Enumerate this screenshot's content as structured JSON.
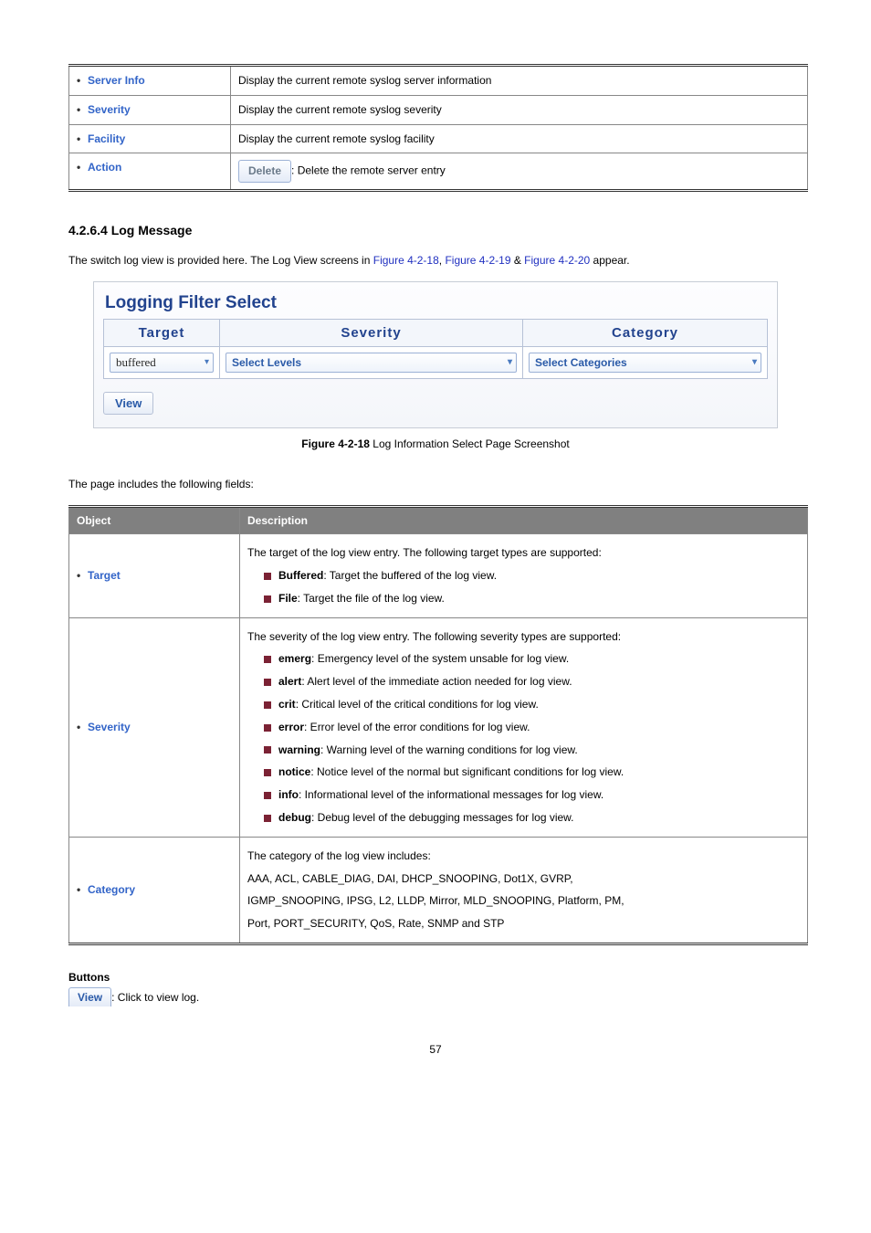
{
  "top_table": {
    "rows": [
      {
        "obj": "Server Info",
        "desc": "Display the current remote syslog server information"
      },
      {
        "obj": "Severity",
        "desc": "Display the current remote syslog severity"
      },
      {
        "obj": "Facility",
        "desc": "Display the current remote syslog facility"
      },
      {
        "obj": "Action",
        "btn": "Delete",
        "desc_suffix": ": Delete the remote server entry"
      }
    ]
  },
  "section_number": "4.2.6.4 Log Message",
  "intro_pre": "The switch log view is provided here. The Log View screens in ",
  "figlink1": "Figure 4-2-18",
  "intro_sep1": ", ",
  "figlink2": "Figure 4-2-19",
  "intro_sep2": " & ",
  "figlink3": "Figure 4-2-20",
  "intro_post": " appear.",
  "screenshot": {
    "title": "Logging Filter Select",
    "headers": [
      "Target",
      "Severity",
      "Category"
    ],
    "target_value": "buffered",
    "severity_value": "Select Levels",
    "category_value": "Select Categories",
    "view_btn": "View"
  },
  "figcap_b": "Figure 4-2-18",
  "figcap_rest": " Log Information Select Page Screenshot",
  "fields_intro": "The page includes the following fields:",
  "obj_hdr": "Object",
  "desc_hdr": "Description",
  "table2": {
    "target": {
      "label": "Target",
      "lead": "The target of the log view entry. The following target types are supported:",
      "items": [
        {
          "b": "Buffered",
          "rest": ": Target the buffered of the log view."
        },
        {
          "b": "File",
          "rest": ": Target the file of the log view."
        }
      ]
    },
    "severity": {
      "label": "Severity",
      "lead": "The severity of the log view entry. The following severity types are supported:",
      "items": [
        {
          "b": "emerg",
          "rest": ": Emergency level of the system unsable for log view."
        },
        {
          "b": "alert",
          "rest": ": Alert level of the immediate action needed for log view."
        },
        {
          "b": "crit",
          "rest": ": Critical level of the critical conditions for log view."
        },
        {
          "b": "error",
          "rest": ": Error level of the error conditions for log view."
        },
        {
          "b": "warning",
          "rest": ": Warning level of the warning conditions for log view."
        },
        {
          "b": "notice",
          "rest": ": Notice level of the normal but significant conditions for log view."
        },
        {
          "b": "info",
          "rest": ": Informational level of the informational messages for log view."
        },
        {
          "b": "debug",
          "rest": ": Debug level of the debugging messages for log view."
        }
      ]
    },
    "category": {
      "label": "Category",
      "lead": "The category of the log view includes:",
      "lines": [
        "AAA, ACL, CABLE_DIAG, DAI, DHCP_SNOOPING, Dot1X, GVRP,",
        "IGMP_SNOOPING, IPSG, L2, LLDP, Mirror, MLD_SNOOPING, Platform, PM,",
        "Port, PORT_SECURITY, QoS, Rate, SNMP and STP"
      ]
    }
  },
  "buttons_label": "Buttons",
  "view_btn2": "View",
  "view_btn_text": ": Click to view log.",
  "page_num": "57"
}
